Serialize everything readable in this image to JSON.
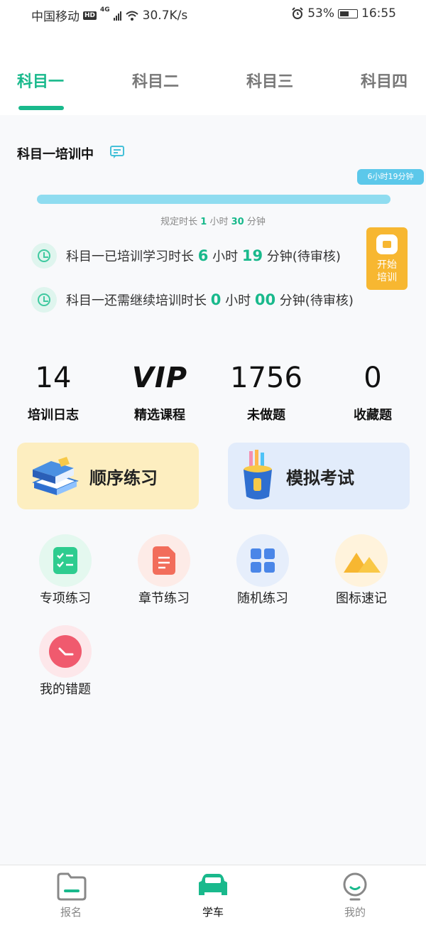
{
  "status_bar": {
    "carrier": "中国移动",
    "hd": "HD",
    "network": "4G",
    "speed": "30.7K/s",
    "battery": "53%",
    "time": "16:55"
  },
  "tabs": [
    {
      "label": "科目一",
      "active": true
    },
    {
      "label": "科目二",
      "active": false
    },
    {
      "label": "科目三",
      "active": false
    },
    {
      "label": "科目四",
      "active": false
    }
  ],
  "training": {
    "title": "科目一培训中",
    "progress_tooltip": "6小时19分钟",
    "progress_fraction": 1.0,
    "required": {
      "prefix": "规定时长",
      "hours": "1",
      "hours_unit": "小时",
      "minutes": "30",
      "minutes_unit": "分钟"
    },
    "trained": {
      "prefix": "科目一已培训学习时长",
      "hours": "6",
      "hours_unit": "小时",
      "minutes": "19",
      "minutes_unit": "分钟(待审核)"
    },
    "remaining": {
      "prefix": "科目一还需继续培训时长",
      "hours": "0",
      "hours_unit": "小时",
      "minutes": "00",
      "minutes_unit": "分钟(待审核)"
    },
    "start_button": {
      "line1": "开始",
      "line2": "培训"
    }
  },
  "stats": [
    {
      "value": "14",
      "label": "培训日志"
    },
    {
      "value": "VIP",
      "label": "精选课程"
    },
    {
      "value": "1756",
      "label": "未做题"
    },
    {
      "value": "0",
      "label": "收藏题"
    }
  ],
  "cards": {
    "sequential": "顺序练习",
    "mock_exam": "模拟考试"
  },
  "tools": [
    {
      "label": "专项练习",
      "icon": "checklist-icon"
    },
    {
      "label": "章节练习",
      "icon": "document-icon"
    },
    {
      "label": "随机练习",
      "icon": "grid-icon"
    },
    {
      "label": "图标速记",
      "icon": "mountain-icon"
    },
    {
      "label": "我的错题",
      "icon": "clock-icon"
    }
  ],
  "bottom_nav": [
    {
      "label": "报名",
      "active": false
    },
    {
      "label": "学车",
      "active": true
    },
    {
      "label": "我的",
      "active": false
    }
  ],
  "colors": {
    "accent": "#19b98c",
    "progress": "#8fdcf0",
    "start_button": "#f7b731"
  }
}
